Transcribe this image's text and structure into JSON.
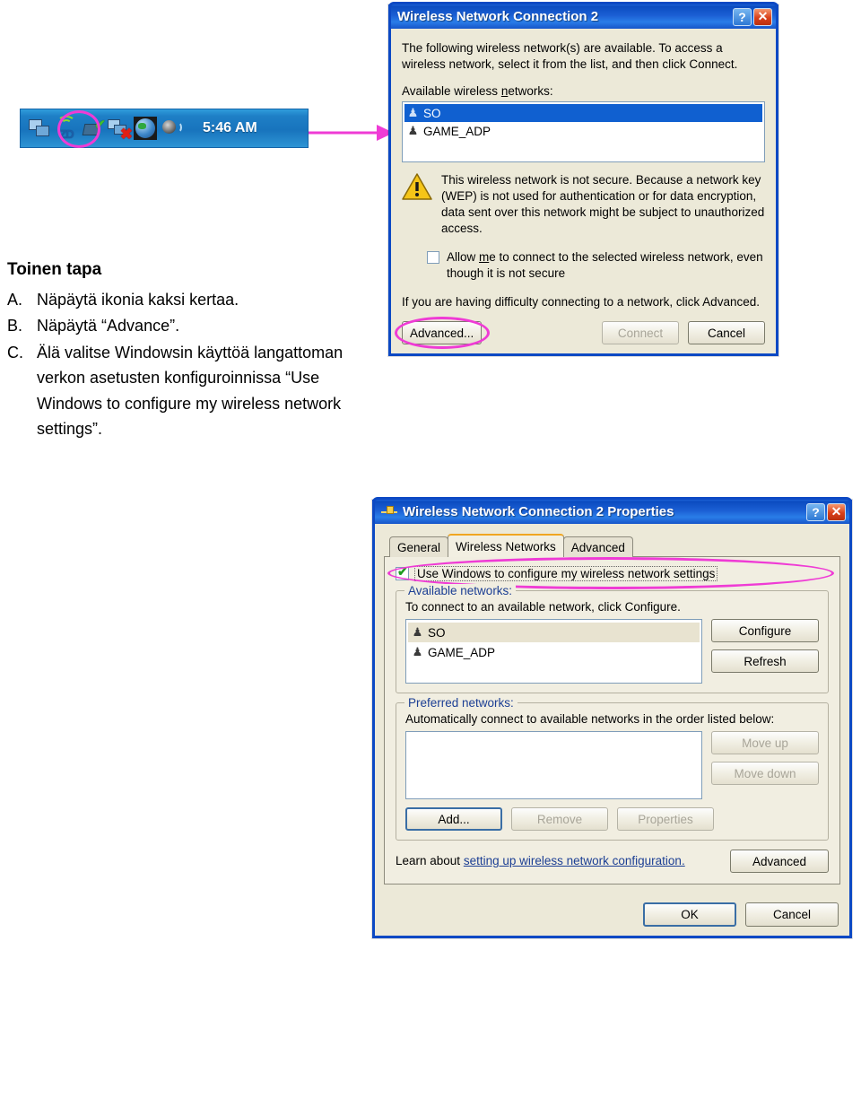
{
  "tray": {
    "clock": "5:46 AM",
    "icons": [
      {
        "name": "network-connections-icon",
        "label": "Network Connections"
      },
      {
        "name": "zd-wireless-utility-icon",
        "label": "ZD",
        "highlighted": true
      },
      {
        "name": "network-connected-check-icon",
        "label": "Connected"
      },
      {
        "name": "network-disconnected-icon",
        "label": "Network disconnected"
      },
      {
        "name": "internet-globe-icon",
        "label": "Internet"
      },
      {
        "name": "volume-speaker-icon",
        "label": "Volume"
      }
    ]
  },
  "instructions": {
    "title": "Toinen tapa",
    "items": [
      {
        "letter": "A.",
        "text": "Näpäytä ikonia kaksi kertaa."
      },
      {
        "letter": "B.",
        "text": "Näpäytä “Advance”."
      },
      {
        "letter": "C.",
        "text": "Älä valitse Windowsin käyttöä langattoman verkon asetusten konfiguroinnissa “Use Windows to configure my wireless network settings”."
      }
    ]
  },
  "dialog1": {
    "title": "Wireless Network Connection 2",
    "help_button": "?",
    "close_button": "✕",
    "intro": "The following wireless network(s) are available. To access a wireless network, select it from the list, and then click Connect.",
    "list_label": "Available wireless networks:",
    "networks": [
      {
        "name": "SO",
        "selected": true
      },
      {
        "name": "GAME_ADP",
        "selected": false
      }
    ],
    "warning": "This wireless network is not secure. Because a network key (WEP) is not used for authentication or for data encryption, data sent over this network might be subject to unauthorized access.",
    "checkbox": {
      "label": "Allow me to connect to the selected wireless network, even though it is not secure",
      "checked": false
    },
    "hint": "If you are having difficulty connecting to a network, click Advanced.",
    "buttons": {
      "advanced": "Advanced...",
      "connect": "Connect",
      "cancel": "Cancel"
    }
  },
  "dialog2": {
    "title": "Wireless Network Connection 2 Properties",
    "help_button": "?",
    "close_button": "✕",
    "tabs": [
      {
        "label": "General",
        "active": false
      },
      {
        "label": "Wireless Networks",
        "active": true
      },
      {
        "label": "Advanced",
        "active": false
      }
    ],
    "use_windows_checkbox": {
      "label": "Use Windows to configure my wireless network settings",
      "checked": true,
      "highlighted": true
    },
    "available_networks": {
      "legend": "Available networks:",
      "description": "To connect to an available network, click Configure.",
      "networks": [
        {
          "name": "SO",
          "selected": true
        },
        {
          "name": "GAME_ADP",
          "selected": false
        }
      ],
      "buttons": {
        "configure": "Configure",
        "refresh": "Refresh"
      }
    },
    "preferred_networks": {
      "legend": "Preferred networks:",
      "description": "Automatically connect to available networks in the order listed below:",
      "networks": [],
      "buttons": {
        "move_up": "Move up",
        "move_down": "Move down",
        "add": "Add...",
        "remove": "Remove",
        "properties": "Properties"
      }
    },
    "learn": {
      "prefix": "Learn about ",
      "link": "setting up wireless network configuration.",
      "advanced_button": "Advanced"
    },
    "footer": {
      "ok": "OK",
      "cancel": "Cancel"
    }
  },
  "colors": {
    "highlight_magenta": "#ef3bd5",
    "title_blue": "#0c49c4",
    "selection_blue": "#1060d0",
    "dialog_face": "#ece9d8"
  }
}
